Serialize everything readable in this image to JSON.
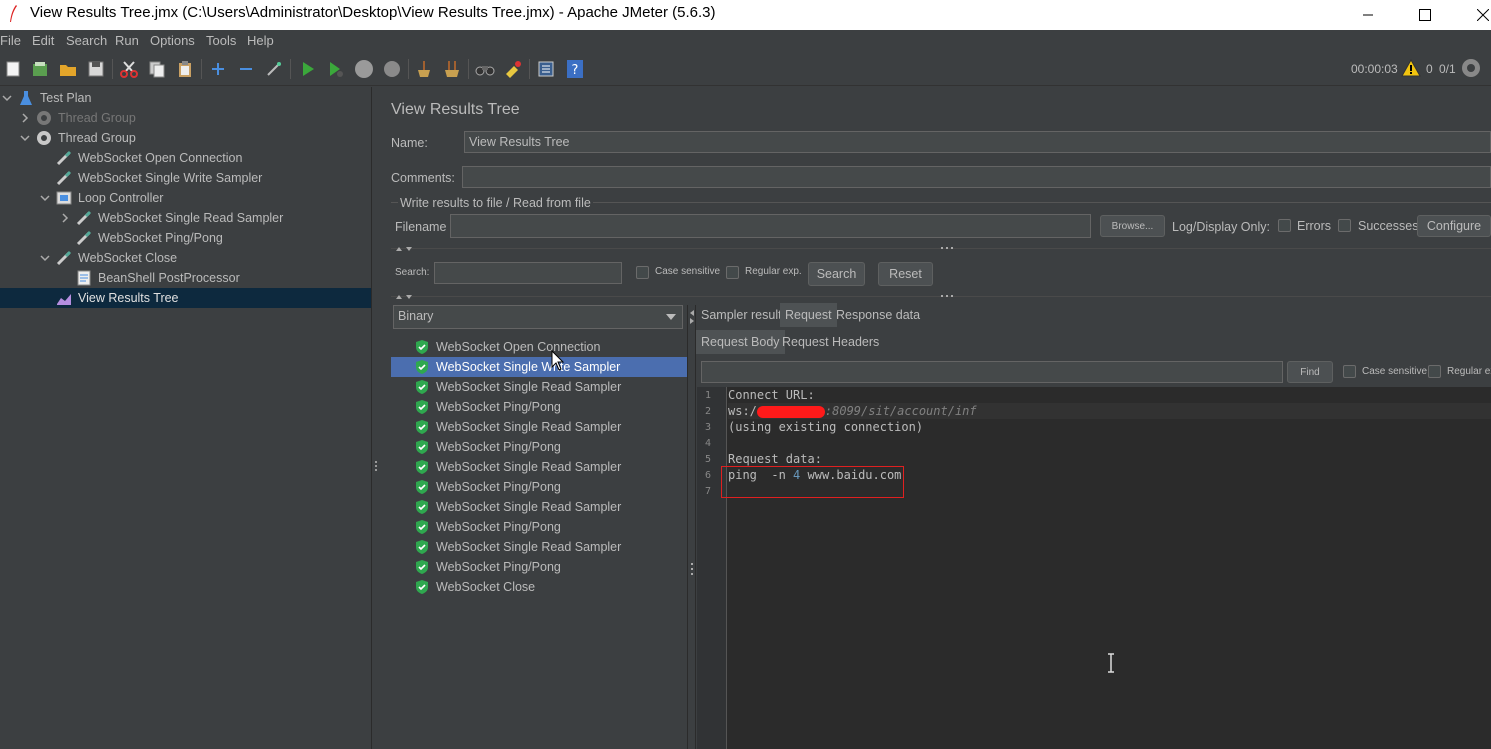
{
  "window": {
    "title": "View Results Tree.jmx (C:\\Users\\Administrator\\Desktop\\View Results Tree.jmx) - Apache JMeter (5.6.3)"
  },
  "menu": [
    "File",
    "Edit",
    "Search",
    "Run",
    "Options",
    "Tools",
    "Help"
  ],
  "toolbar": {
    "elapsed": "00:00:03",
    "warnings": "0",
    "threads": "0/1"
  },
  "tree": {
    "nodes": [
      {
        "label": "Test Plan"
      },
      {
        "label": "Thread Group"
      },
      {
        "label": "Thread Group"
      },
      {
        "label": "WebSocket Open Connection"
      },
      {
        "label": "WebSocket Single Write Sampler"
      },
      {
        "label": "Loop Controller"
      },
      {
        "label": "WebSocket Single Read Sampler"
      },
      {
        "label": "WebSocket Ping/Pong"
      },
      {
        "label": "WebSocket Close"
      },
      {
        "label": "BeanShell PostProcessor"
      },
      {
        "label": "View Results Tree"
      }
    ]
  },
  "panel": {
    "heading": "View Results Tree",
    "name_label": "Name:",
    "name_value": "View Results Tree",
    "comments_label": "Comments:",
    "comments_value": "",
    "file_section": "Write results to file / Read from file",
    "filename_label": "Filename",
    "filename_value": "",
    "browse": "Browse...",
    "log_display": "Log/Display Only:",
    "errors": "Errors",
    "successes": "Successes",
    "configure": "Configure",
    "search_label": "Search:",
    "search_value": "",
    "case_sensitive": "Case sensitive",
    "regular_exp": "Regular exp.",
    "search_button": "Search",
    "reset_button": "Reset"
  },
  "renderer": {
    "selected": "Binary"
  },
  "results": [
    "WebSocket Open Connection",
    "WebSocket Single Write Sampler",
    "WebSocket Single Read Sampler",
    "WebSocket Ping/Pong",
    "WebSocket Single Read Sampler",
    "WebSocket Ping/Pong",
    "WebSocket Single Read Sampler",
    "WebSocket Ping/Pong",
    "WebSocket Single Read Sampler",
    "WebSocket Ping/Pong",
    "WebSocket Single Read Sampler",
    "WebSocket Ping/Pong",
    "WebSocket Close"
  ],
  "detail": {
    "tabs": [
      "Sampler result",
      "Request",
      "Response data"
    ],
    "active_tab": "Request",
    "subtabs": [
      "Request Body",
      "Request Headers"
    ],
    "active_subtab": "Request Body",
    "find_value": "",
    "find_button": "Find",
    "case_sensitive": "Case sensitive",
    "regular_exp": "Regular ex",
    "line_numbers": [
      "1",
      "2",
      "3",
      "4",
      "5",
      "6",
      "7"
    ],
    "lines": {
      "l1": "Connect URL:",
      "l2_prefix": "ws:/",
      "l2_suffix": ":8099/sit/account/inf",
      "l3": "(using existing connection)",
      "l5": "Request data:",
      "l6_a": "ping  -n ",
      "l6_num": "4",
      "l6_b": " www.baidu.com"
    }
  },
  "colors": {
    "background": "#3c3f41",
    "selection": "#4b6eaf",
    "tree_selection": "#0d293e",
    "editor": "#2b2b2b",
    "redaction": "#ff0000",
    "highlight_box": "#e02020"
  }
}
